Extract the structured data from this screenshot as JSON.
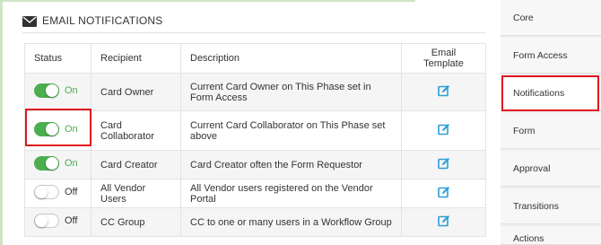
{
  "section": {
    "title": "EMAIL NOTIFICATIONS",
    "icon": "envelope-icon"
  },
  "table": {
    "headers": {
      "status": "Status",
      "recipient": "Recipient",
      "description": "Description",
      "template": "Email Template"
    },
    "rows": [
      {
        "status": "On",
        "enabled": true,
        "recipient": "Card Owner",
        "description": "Current Card Owner on This Phase set in Form Access",
        "template_icon": "edit-icon"
      },
      {
        "status": "On",
        "enabled": true,
        "recipient": "Card Collaborator",
        "description": "Current Card Collaborator on This Phase set above",
        "template_icon": "edit-icon"
      },
      {
        "status": "On",
        "enabled": true,
        "recipient": "Card Creator",
        "description": "Card Creator often the Form Requestor",
        "template_icon": "edit-icon"
      },
      {
        "status": "Off",
        "enabled": false,
        "recipient": "All Vendor Users",
        "description": "All Vendor users registered on the Vendor Portal",
        "template_icon": "edit-icon"
      },
      {
        "status": "Off",
        "enabled": false,
        "recipient": "CC Group",
        "description": "CC to one or many users in a Workflow Group",
        "template_icon": "edit-icon"
      }
    ]
  },
  "sidebar": {
    "items": [
      {
        "label": "Core"
      },
      {
        "label": "Form Access"
      },
      {
        "label": "Notifications",
        "active": true
      },
      {
        "label": "Form"
      },
      {
        "label": "Approval"
      },
      {
        "label": "Transitions"
      },
      {
        "label": "Actions"
      }
    ]
  },
  "colors": {
    "toggle_on": "#4bae4f",
    "edit_icon": "#2a9fd8",
    "highlight": "#e0161e",
    "accent_border": "#cfe5c5"
  }
}
